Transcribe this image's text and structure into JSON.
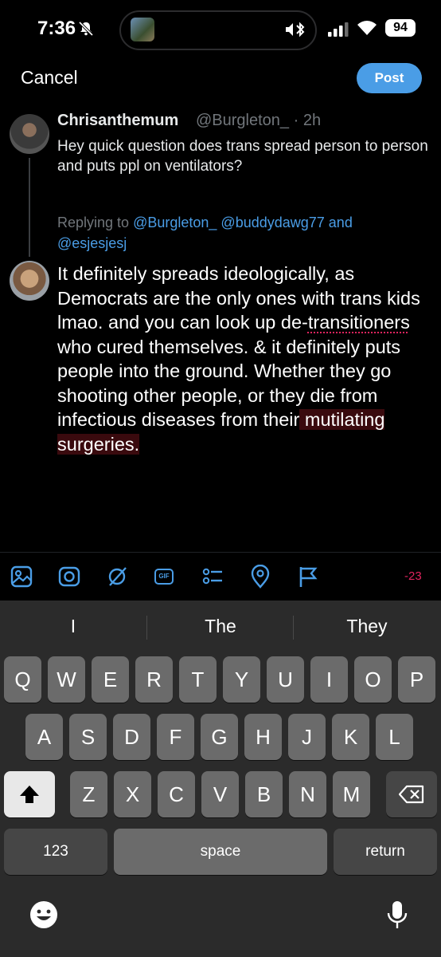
{
  "status_bar": {
    "time": "7:36",
    "battery": "94"
  },
  "compose": {
    "cancel_label": "Cancel",
    "post_label": "Post"
  },
  "parent_tweet": {
    "name": "Chrisanthemum",
    "handle_time": "@Burgleton_ · 2h",
    "text": "Hey quick question does trans spread person to person and puts ppl on ventilators?"
  },
  "replying": {
    "prefix": "Replying to ",
    "mentions": [
      "@Burgleton_",
      "@buddydawg77",
      "@esjesjesj"
    ],
    "and": " and"
  },
  "reply_draft": {
    "part1": "It definitely spreads ideologically, as Democrats are the only ones with trans kids lmao. and you can look up de-",
    "misspelled": "transitioners",
    "part2": " who cured themselves. & it definitely puts people into the ground. Whether they go shooting other people, or they die from infectious diseases from their",
    "over_limit": " mutilating surgeries."
  },
  "toolbar": {
    "icons": [
      "image-icon",
      "camera-icon",
      "grok-icon",
      "gif-icon",
      "poll-icon",
      "location-icon",
      "flag-icon"
    ],
    "gif_label": "GIF",
    "char_count": "-23"
  },
  "keyboard": {
    "suggestions": [
      "I",
      "The",
      "They"
    ],
    "row1": [
      "Q",
      "W",
      "E",
      "R",
      "T",
      "Y",
      "U",
      "I",
      "O",
      "P"
    ],
    "row2": [
      "A",
      "S",
      "D",
      "F",
      "G",
      "H",
      "J",
      "K",
      "L"
    ],
    "row3": [
      "Z",
      "X",
      "C",
      "V",
      "B",
      "N",
      "M"
    ],
    "numbers_label": "123",
    "space_label": "space",
    "return_label": "return"
  },
  "colors": {
    "accent": "#4a9de6",
    "over_limit": "#e0245e",
    "background": "#000000"
  }
}
